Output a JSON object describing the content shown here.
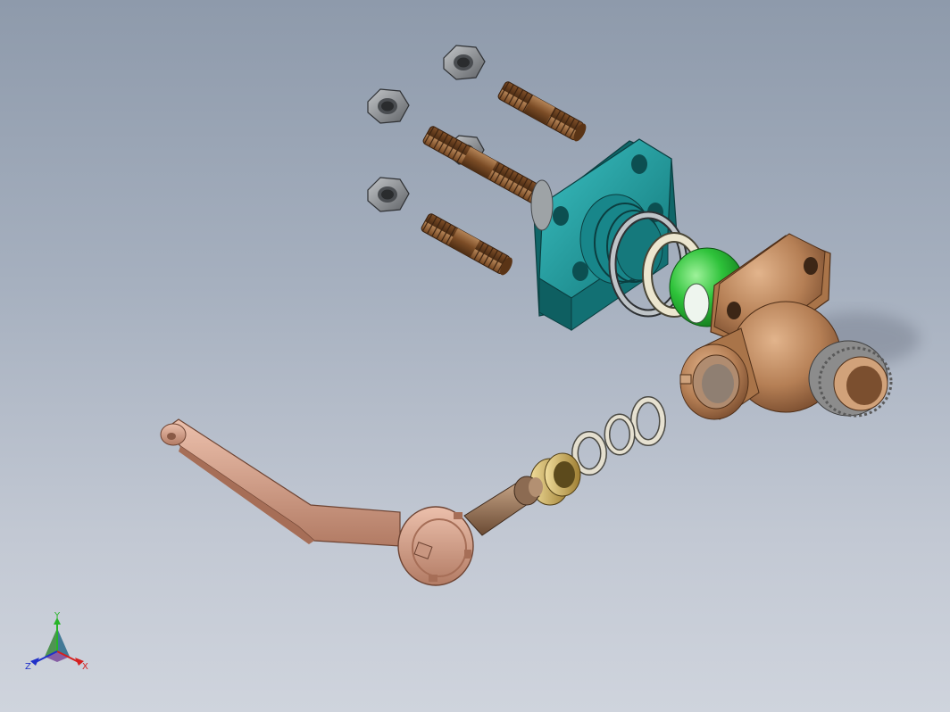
{
  "viewport": {
    "background_top": "#8e9aab",
    "background_bottom": "#cfd4dd"
  },
  "triad": {
    "x_label": "X",
    "y_label": "Y",
    "z_label": "Z",
    "x_color": "#d42020",
    "y_color": "#28b428",
    "z_color": "#2030c8"
  },
  "parts": [
    "hex-nut",
    "stud-bolt",
    "flange-cover",
    "seal-ring",
    "seat-ring",
    "ball",
    "valve-body",
    "washer",
    "stem-gland",
    "stem",
    "handle-lever"
  ],
  "colors": {
    "nut": "#8f9296",
    "stud": "#8a5a30",
    "flange": "#1e9a9c",
    "ball": "#2ec23a",
    "body": "#b57f55",
    "handle": "#d6a08a",
    "washer": "#d9d4c4",
    "gland": "#c9a850"
  }
}
